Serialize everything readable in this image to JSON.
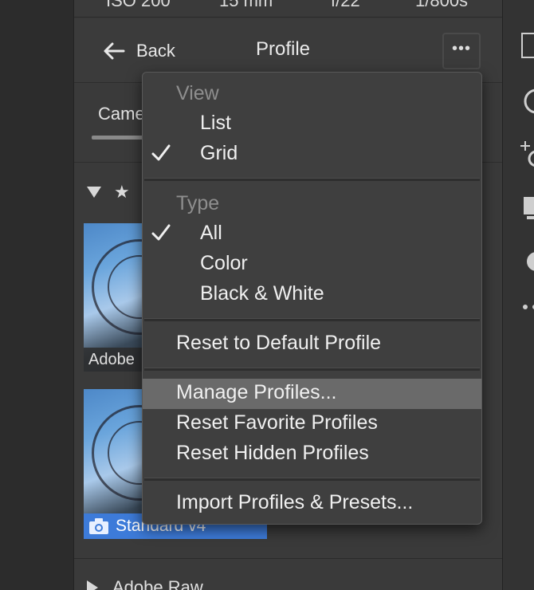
{
  "exif": {
    "iso": "ISO 200",
    "focal": "15 mm",
    "aperture": "f/22",
    "shutter": "1/800s"
  },
  "header": {
    "back_label": "Back",
    "title": "Profile",
    "more_icon": "ellipsis-icon"
  },
  "tabs": {
    "camera_label": "Came"
  },
  "favorites": {
    "thumbs": [
      {
        "label": "Adobe"
      },
      {
        "label": "Standard v4",
        "selected": true
      }
    ]
  },
  "next_group": {
    "label": "Adobe Raw"
  },
  "menu": {
    "view": {
      "label": "View",
      "items": [
        {
          "label": "List",
          "checked": false
        },
        {
          "label": "Grid",
          "checked": true
        }
      ]
    },
    "type": {
      "label": "Type",
      "items": [
        {
          "label": "All",
          "checked": true
        },
        {
          "label": "Color",
          "checked": false
        },
        {
          "label": "Black & White",
          "checked": false
        }
      ]
    },
    "reset_default": "Reset to Default Profile",
    "manage": "Manage Profiles...",
    "reset_favorites": "Reset Favorite Profiles",
    "reset_hidden": "Reset Hidden Profiles",
    "import": "Import Profiles & Presets..."
  },
  "colors": {
    "selection_blue": "#3d7bd9",
    "menu_hover": "#6a6a6a",
    "panel_bg": "#3a3a3a"
  }
}
